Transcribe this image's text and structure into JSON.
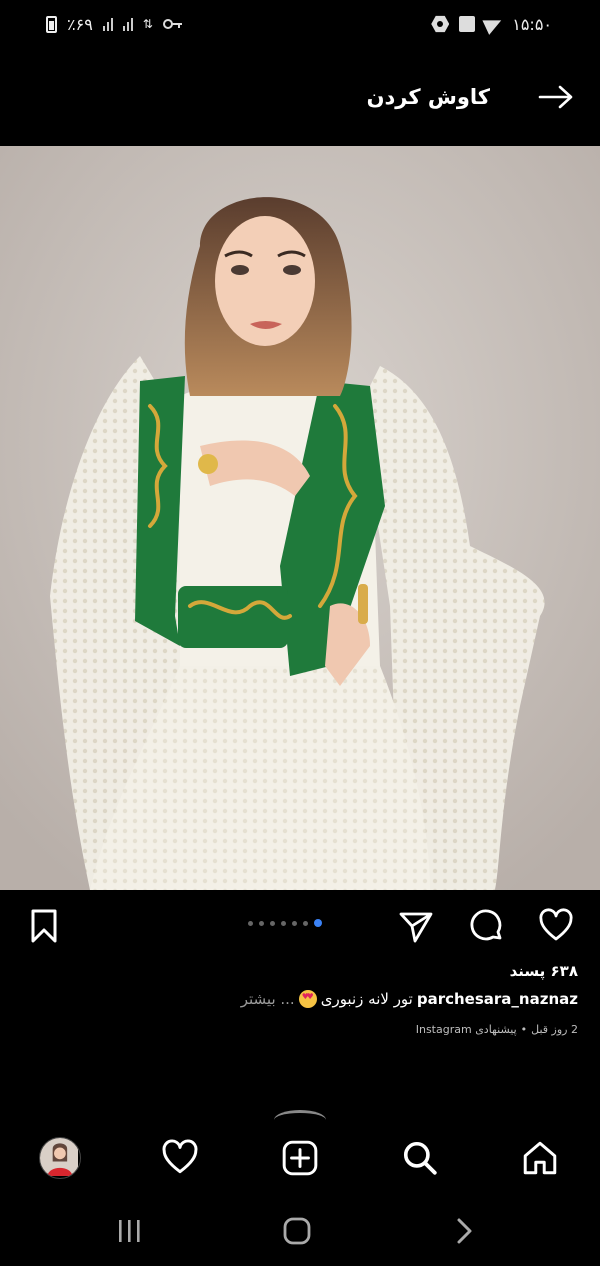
{
  "status_bar": {
    "battery_text": "٪۶۹",
    "time": "۱۵:۵۰",
    "icons": [
      "battery-icon",
      "signal-icon",
      "signal-icon",
      "data-icon",
      "key-icon",
      "hexagon-icon",
      "image-icon",
      "telegram-icon"
    ]
  },
  "header": {
    "title": "کاوش کردن",
    "back_icon": "arrow-right-icon"
  },
  "post": {
    "carousel_total": 7,
    "carousel_active": 7,
    "likes": "۶۳۸ پسند",
    "username": "parchesara_naznaz",
    "caption_text": "تور لانه زنبوری",
    "caption_more": "... بیشتر",
    "emoji": "heart-eyes-emoji",
    "time_ago": "2 روز قبل",
    "separator": "•",
    "suggested": "پیشنهادی Instagram"
  },
  "actions": {
    "icons": [
      "bookmark-icon",
      "share-icon",
      "comment-icon",
      "like-icon"
    ]
  },
  "bottom_nav": {
    "icons": [
      "profile-avatar",
      "activity-icon",
      "create-icon",
      "search-icon",
      "home-icon"
    ]
  },
  "system_nav": {
    "icons": [
      "recents-icon",
      "home-button-icon",
      "back-button-icon"
    ]
  },
  "colors": {
    "background": "#000000",
    "accent_dot": "#3b82f6",
    "muted_text": "#9a9a9a"
  }
}
